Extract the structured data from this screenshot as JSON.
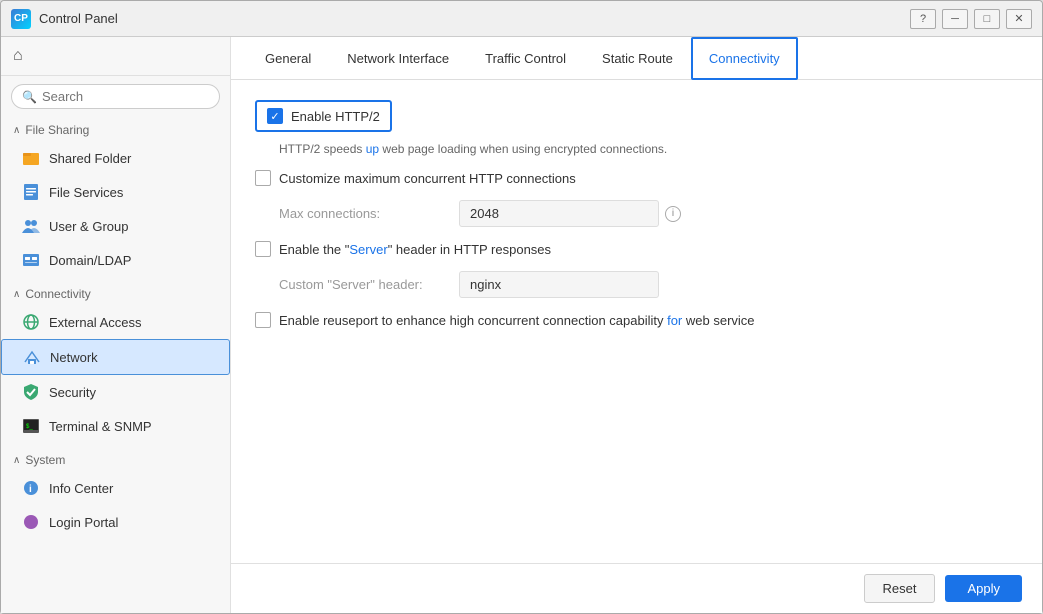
{
  "window": {
    "title": "Control Panel",
    "icon": "CP"
  },
  "titlebar": {
    "help_label": "?",
    "minimize_label": "─",
    "maximize_label": "□",
    "close_label": "✕"
  },
  "sidebar": {
    "search_placeholder": "Search",
    "home_icon": "⌂",
    "sections": [
      {
        "id": "file-sharing",
        "label": "File Sharing",
        "collapsible": true,
        "expanded": true,
        "chevron": "∧"
      },
      {
        "id": "connectivity",
        "label": "Connectivity",
        "collapsible": true,
        "expanded": true,
        "chevron": "∧"
      },
      {
        "id": "system",
        "label": "System",
        "collapsible": true,
        "expanded": true,
        "chevron": "∧"
      }
    ],
    "items": [
      {
        "id": "shared-folder",
        "label": "Shared Folder",
        "icon": "📁",
        "section": "file-sharing",
        "active": false
      },
      {
        "id": "file-services",
        "label": "File Services",
        "icon": "📋",
        "section": "file-sharing",
        "active": false
      },
      {
        "id": "user-group",
        "label": "User & Group",
        "icon": "👥",
        "section": "file-sharing",
        "active": false
      },
      {
        "id": "domain-ldap",
        "label": "Domain/LDAP",
        "icon": "🖥",
        "section": "file-sharing",
        "active": false
      },
      {
        "id": "external-access",
        "label": "External Access",
        "icon": "🌐",
        "section": "connectivity",
        "active": false
      },
      {
        "id": "network",
        "label": "Network",
        "icon": "🏠",
        "section": "connectivity",
        "active": true
      },
      {
        "id": "security",
        "label": "Security",
        "icon": "🛡",
        "section": "connectivity",
        "active": false
      },
      {
        "id": "terminal-snmp",
        "label": "Terminal & SNMP",
        "icon": "⬛",
        "section": "connectivity",
        "active": false
      },
      {
        "id": "info-center",
        "label": "Info Center",
        "icon": "ℹ",
        "section": "system",
        "active": false
      },
      {
        "id": "login-portal",
        "label": "Login Portal",
        "icon": "🟣",
        "section": "system",
        "active": false
      }
    ]
  },
  "tabs": [
    {
      "id": "general",
      "label": "General",
      "active": false
    },
    {
      "id": "network-interface",
      "label": "Network Interface",
      "active": false
    },
    {
      "id": "traffic-control",
      "label": "Traffic Control",
      "active": false
    },
    {
      "id": "static-route",
      "label": "Static Route",
      "active": false
    },
    {
      "id": "connectivity",
      "label": "Connectivity",
      "active": true
    }
  ],
  "settings": {
    "http2": {
      "label": "Enable HTTP/2",
      "checked": true,
      "description_parts": [
        {
          "text": "HTTP/2 speeds ",
          "type": "normal"
        },
        {
          "text": "up",
          "type": "highlight"
        },
        {
          "text": " web page loading when using encrypted connections.",
          "type": "normal"
        }
      ],
      "description": "HTTP/2 speeds up web page loading when using encrypted connections."
    },
    "max_connections": {
      "label_checkbox": "Customize maximum concurrent HTTP connections",
      "checked": false,
      "field_label": "Max connections:",
      "field_value": "2048",
      "info": "i"
    },
    "server_header": {
      "label": "Enable the \"Server\" header in HTTP responses",
      "checked": false,
      "field_label": "Custom \"Server\" header:",
      "field_value": "nginx"
    },
    "reuseport": {
      "label_parts": [
        {
          "text": "Enable reuseport to enhance high concurrent connection capability ",
          "type": "normal"
        },
        {
          "text": "for",
          "type": "highlight"
        },
        {
          "text": " web service",
          "type": "normal"
        }
      ],
      "label": "Enable reuseport to enhance high concurrent connection capability for web service",
      "checked": false
    }
  },
  "footer": {
    "reset_label": "Reset",
    "apply_label": "Apply"
  }
}
